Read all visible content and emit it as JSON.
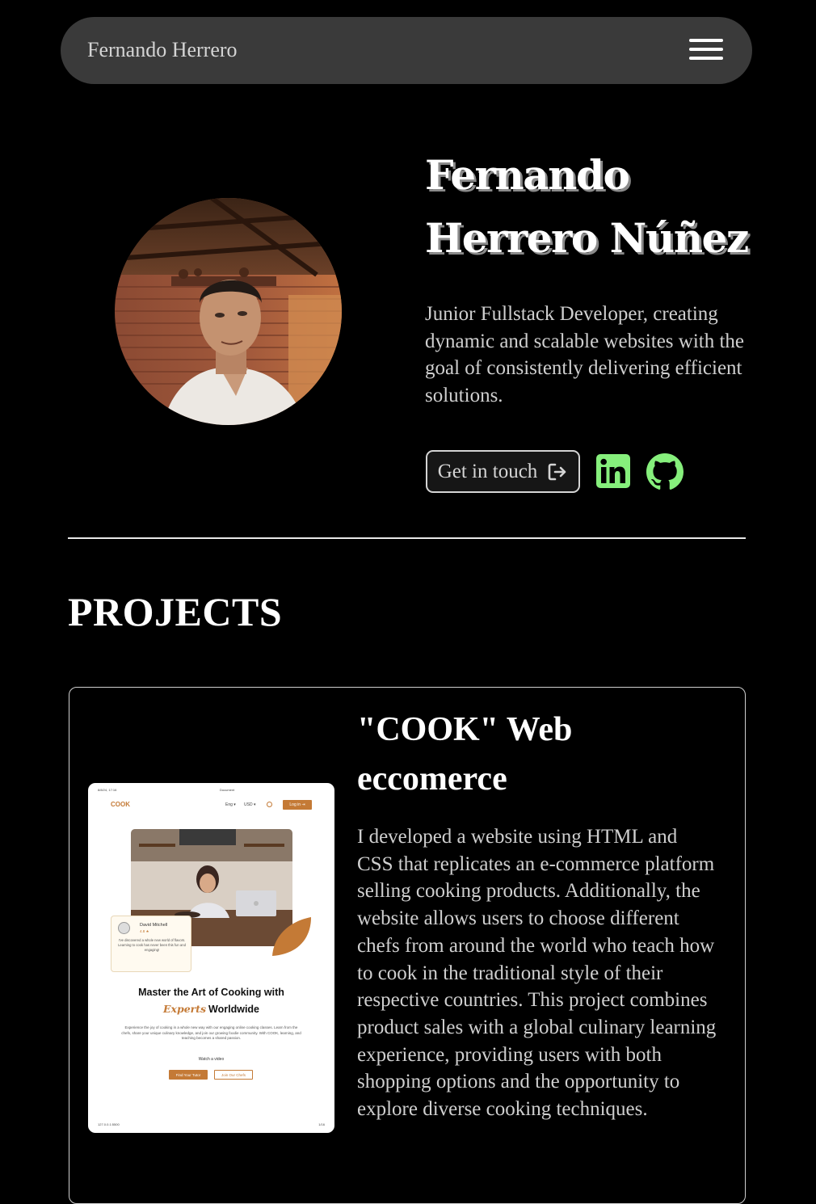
{
  "nav": {
    "title": "Fernando Herrero"
  },
  "hero": {
    "name_line1": "Fernando",
    "name_line2": "Herrero Núñez",
    "description": "Junior Fullstack Developer, creating dynamic and scalable websites with the goal of consistently delivering efficient solutions.",
    "contact_label": "Get in touch"
  },
  "colors": {
    "accent_green": "#86ef7c",
    "cook_brand": "#c47a36"
  },
  "icons": [
    "menu-icon",
    "logout-arrow-icon",
    "linkedin-icon",
    "github-icon"
  ],
  "projects": {
    "heading": "PROJECTS",
    "items": [
      {
        "title_line1": "\"COOK\" Web",
        "title_line2": "eccomerce",
        "description": "I developed a website using HTML and CSS that replicates an e-commerce platform selling cooking products. Additionally, the website allows users to choose different chefs from around the world who teach how to cook in the traditional style of their respective countries. This project combines product sales with a global culinary learning experience, providing users with both shopping options and the opportunity to explore diverse cooking techniques.",
        "screenshot": {
          "top_left": "8/8/24, 17:16",
          "top_center": "Document",
          "logo": "COOK",
          "lang": "Eng ▾",
          "currency": "USD ▾",
          "login": "Log in ⇥",
          "reviewer_name": "David Mitchell",
          "reviewer_rating": "4.8 ★",
          "review_text": "I've discovered a whole new world of flavors. Learning to cook has never been this fun and engaging!",
          "headline_1": "Master the Art of Cooking with",
          "headline_accent": "Experts",
          "headline_2": "Worldwide",
          "paragraph": "Experience the joy of cooking in a whole new way with our engaging online cooking classes. Learn from the chefs, share your unique culinary knowledge, and join our growing foodie community. With COOK, learning, and teaching becomes a shared passion.",
          "watch": "Watch a video",
          "btn_primary": "Find Your Tutor",
          "btn_secondary": "Join Our Chefs",
          "footer_left": "127.0.0.1:5500",
          "footer_right": "1/16"
        }
      }
    ]
  }
}
